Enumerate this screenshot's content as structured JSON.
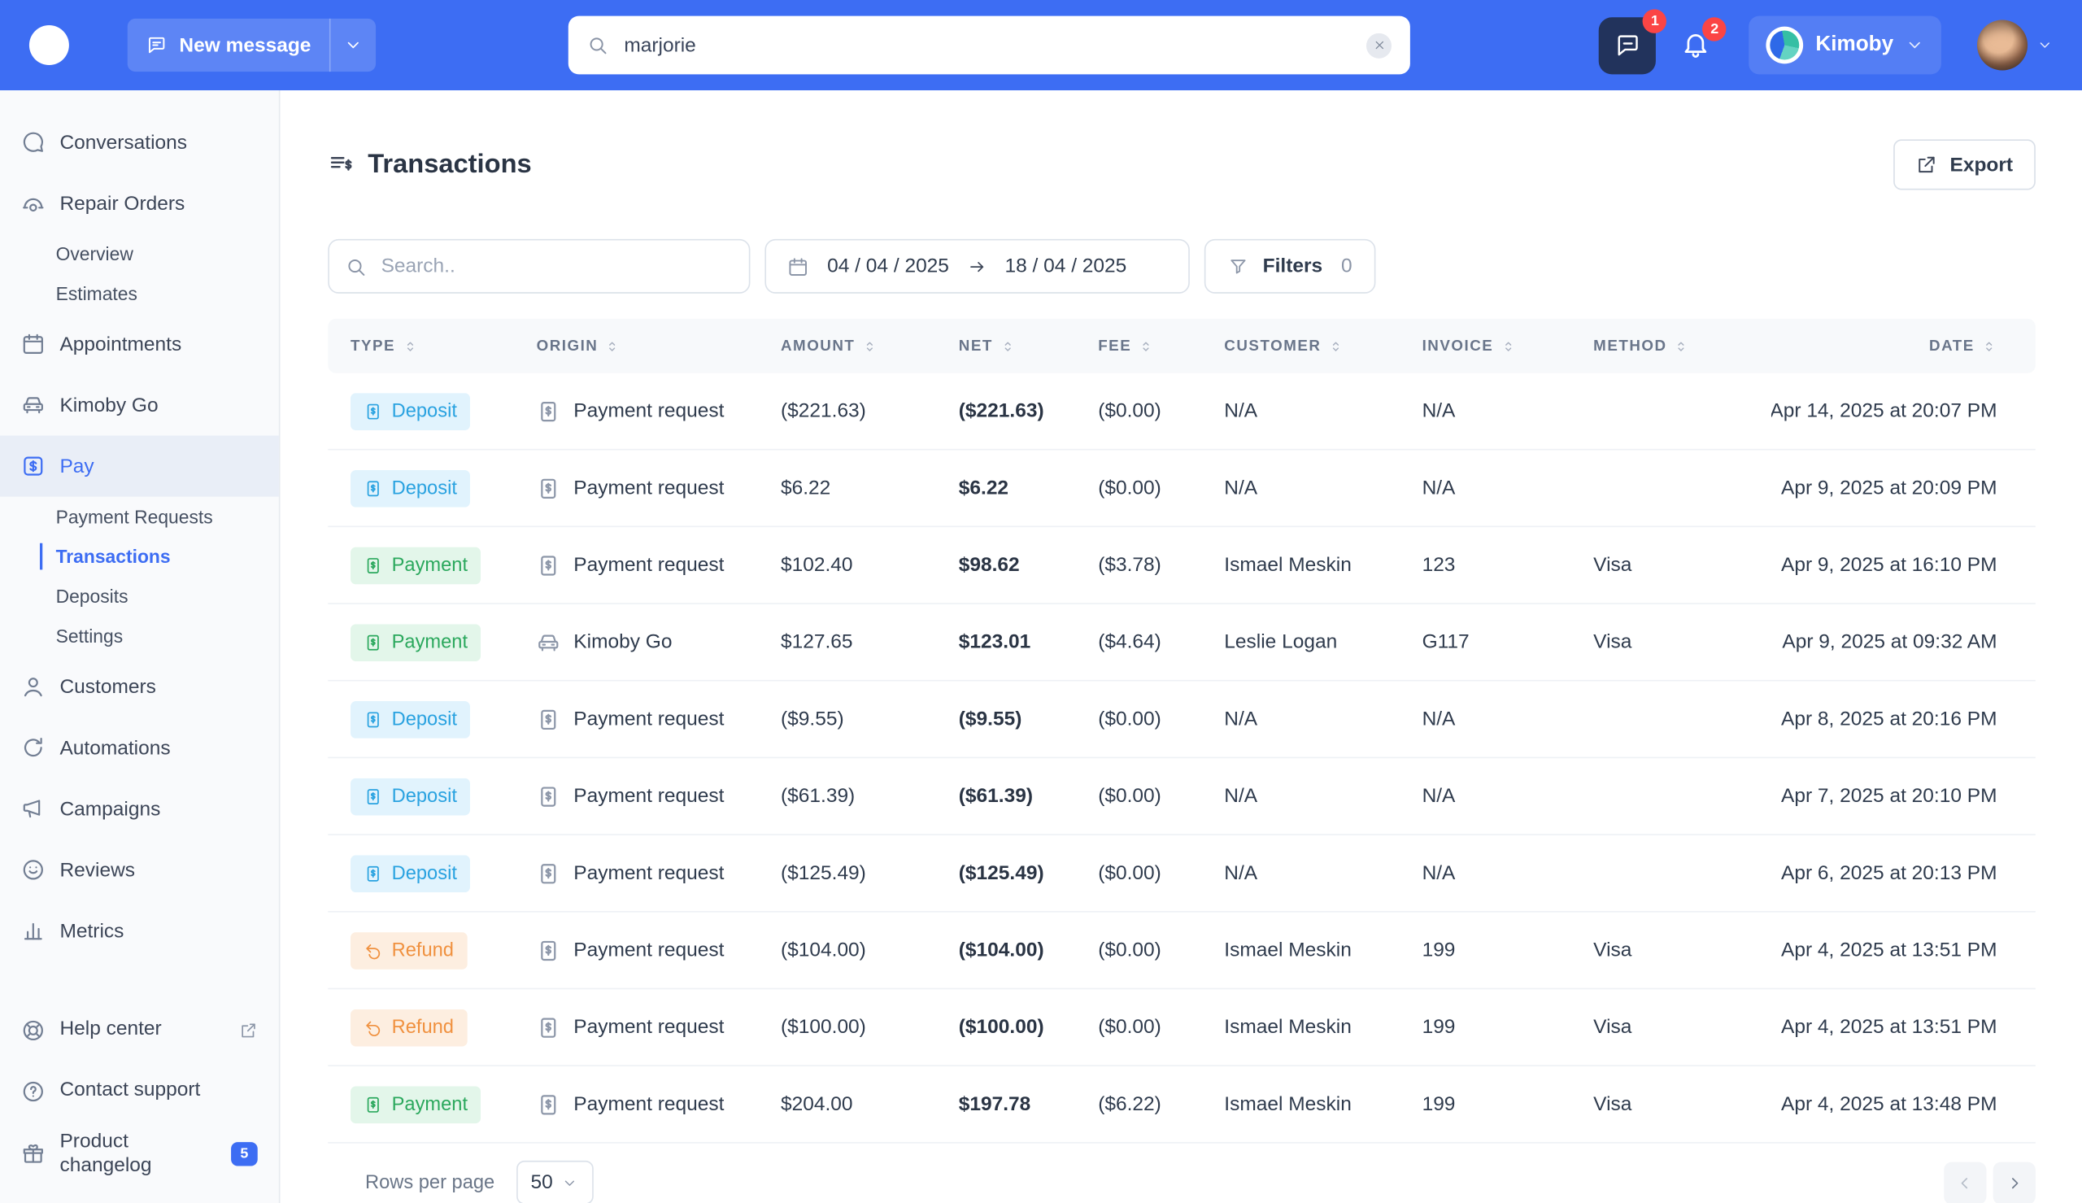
{
  "theme": {
    "topbar_blue": "#3D6DF3",
    "accent": "#3D6DF3",
    "deposit_color": "#29A2E0",
    "payment_color": "#2BA85D",
    "refund_color": "#F0913F",
    "notification_red": "#FB4545"
  },
  "topbar": {
    "new_message_label": "New message",
    "search_value": "marjorie",
    "inbox_badge": "1",
    "notifications_badge": "2",
    "brand": "Kimoby"
  },
  "sidebar": {
    "items": [
      {
        "label": "Conversations",
        "icon": "chat"
      },
      {
        "label": "Repair Orders",
        "icon": "fender"
      },
      {
        "label": "Overview",
        "sub": true
      },
      {
        "label": "Estimates",
        "sub": true
      },
      {
        "label": "Appointments",
        "icon": "calendar"
      },
      {
        "label": "Kimoby Go",
        "icon": "car"
      },
      {
        "label": "Pay",
        "icon": "pay",
        "active": true
      },
      {
        "label": "Payment Requests",
        "sub": true
      },
      {
        "label": "Transactions",
        "sub": true,
        "selected": true
      },
      {
        "label": "Deposits",
        "sub": true
      },
      {
        "label": "Settings",
        "sub": true
      },
      {
        "label": "Customers",
        "icon": "user"
      },
      {
        "label": "Automations",
        "icon": "automation"
      },
      {
        "label": "Campaigns",
        "icon": "megaphone"
      },
      {
        "label": "Reviews",
        "icon": "reviews"
      },
      {
        "label": "Metrics",
        "icon": "metrics"
      }
    ],
    "footer_items": [
      {
        "label": "Help center",
        "icon": "help",
        "external": true
      },
      {
        "label": "Contact support",
        "icon": "support"
      },
      {
        "label": "Product changelog",
        "icon": "gift",
        "badge": "5"
      }
    ]
  },
  "main": {
    "title": "Transactions",
    "export_label": "Export",
    "search_placeholder": "Search..",
    "date_from": "04 / 04 / 2025",
    "date_to": "18 / 04 / 2025",
    "filters_label": "Filters",
    "filters_count": "0",
    "table": {
      "columns": [
        "TYPE",
        "ORIGIN",
        "AMOUNT",
        "NET",
        "FEE",
        "CUSTOMER",
        "INVOICE",
        "METHOD",
        "DATE"
      ],
      "rows": [
        {
          "type": "Deposit",
          "type_kind": "deposit",
          "origin": "Payment request",
          "origin_kind": "payment-request",
          "amount": "($221.63)",
          "net": "($221.63)",
          "fee": "($0.00)",
          "customer": "N/A",
          "invoice": "N/A",
          "method": "",
          "date": "Apr 14, 2025 at 20:07 PM"
        },
        {
          "type": "Deposit",
          "type_kind": "deposit",
          "origin": "Payment request",
          "origin_kind": "payment-request",
          "amount": "$6.22",
          "net": "$6.22",
          "fee": "($0.00)",
          "customer": "N/A",
          "invoice": "N/A",
          "method": "",
          "date": "Apr 9, 2025 at 20:09 PM"
        },
        {
          "type": "Payment",
          "type_kind": "payment",
          "origin": "Payment request",
          "origin_kind": "payment-request",
          "amount": "$102.40",
          "net": "$98.62",
          "fee": "($3.78)",
          "customer": "Ismael Meskin",
          "invoice": "123",
          "method": "Visa",
          "date": "Apr 9, 2025 at 16:10 PM"
        },
        {
          "type": "Payment",
          "type_kind": "payment",
          "origin": "Kimoby Go",
          "origin_kind": "kimoby-go",
          "amount": "$127.65",
          "net": "$123.01",
          "fee": "($4.64)",
          "customer": "Leslie Logan",
          "invoice": "G117",
          "method": "Visa",
          "date": "Apr 9, 2025 at 09:32 AM"
        },
        {
          "type": "Deposit",
          "type_kind": "deposit",
          "origin": "Payment request",
          "origin_kind": "payment-request",
          "amount": "($9.55)",
          "net": "($9.55)",
          "fee": "($0.00)",
          "customer": "N/A",
          "invoice": "N/A",
          "method": "",
          "date": "Apr 8, 2025 at 20:16 PM"
        },
        {
          "type": "Deposit",
          "type_kind": "deposit",
          "origin": "Payment request",
          "origin_kind": "payment-request",
          "amount": "($61.39)",
          "net": "($61.39)",
          "fee": "($0.00)",
          "customer": "N/A",
          "invoice": "N/A",
          "method": "",
          "date": "Apr 7, 2025 at 20:10 PM"
        },
        {
          "type": "Deposit",
          "type_kind": "deposit",
          "origin": "Payment request",
          "origin_kind": "payment-request",
          "amount": "($125.49)",
          "net": "($125.49)",
          "fee": "($0.00)",
          "customer": "N/A",
          "invoice": "N/A",
          "method": "",
          "date": "Apr 6, 2025 at 20:13 PM"
        },
        {
          "type": "Refund",
          "type_kind": "refund",
          "origin": "Payment request",
          "origin_kind": "payment-request",
          "amount": "($104.00)",
          "net": "($104.00)",
          "fee": "($0.00)",
          "customer": "Ismael Meskin",
          "invoice": "199",
          "method": "Visa",
          "date": "Apr 4, 2025 at 13:51 PM"
        },
        {
          "type": "Refund",
          "type_kind": "refund",
          "origin": "Payment request",
          "origin_kind": "payment-request",
          "amount": "($100.00)",
          "net": "($100.00)",
          "fee": "($0.00)",
          "customer": "Ismael Meskin",
          "invoice": "199",
          "method": "Visa",
          "date": "Apr 4, 2025 at 13:51 PM"
        },
        {
          "type": "Payment",
          "type_kind": "payment",
          "origin": "Payment request",
          "origin_kind": "payment-request",
          "amount": "$204.00",
          "net": "$197.78",
          "fee": "($6.22)",
          "customer": "Ismael Meskin",
          "invoice": "199",
          "method": "Visa",
          "date": "Apr 4, 2025 at 13:48 PM"
        }
      ]
    },
    "pagination": {
      "rows_per_page_label": "Rows per page",
      "rows_per_page_value": "50"
    }
  }
}
